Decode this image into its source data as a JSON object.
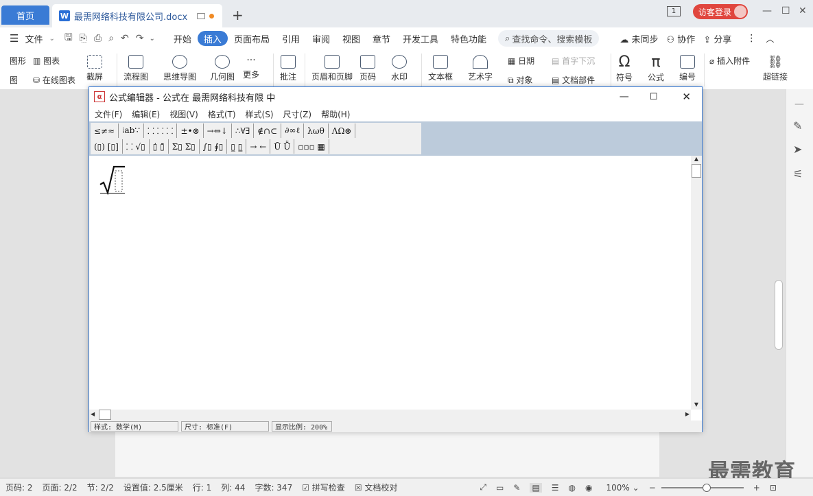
{
  "tabs": {
    "home": "首页",
    "doc": "最需网络科技有限公司.docx",
    "add": "+"
  },
  "topright": {
    "page_indicator": "1",
    "login": "访客登录"
  },
  "menu": {
    "file": "文件",
    "items": [
      "开始",
      "插入",
      "页面布局",
      "引用",
      "审阅",
      "视图",
      "章节",
      "开发工具",
      "特色功能"
    ],
    "active_index": 1,
    "search": "查找命令、搜索模板",
    "sync": "未同步",
    "collab": "协作",
    "share": "分享"
  },
  "ribbon": {
    "shape": "图形",
    "chart": "图表",
    "diagram": "图",
    "online_chart": "在线图表",
    "screenshot": "截屏",
    "flowchart": "流程图",
    "mindmap": "思维导图",
    "geometry": "几何图",
    "more": "更多",
    "comment": "批注",
    "header_footer": "页眉和页脚",
    "page_num": "页码",
    "watermark": "水印",
    "textbox": "文本框",
    "wordart": "艺术字",
    "date": "日期",
    "object": "对象",
    "dropcap": "首字下沉",
    "docpart": "文档部件",
    "symbol": "符号",
    "formula": "公式",
    "numbering": "编号",
    "attach": "插入附件",
    "hyperlink": "超链接"
  },
  "dialog": {
    "title": "公式编辑器 - 公式在 最需网络科技有限 中",
    "menu": [
      "文件(F)",
      "编辑(E)",
      "视图(V)",
      "格式(T)",
      "样式(S)",
      "尺寸(Z)",
      "帮助(H)"
    ],
    "palette_row1": [
      "≤≠≈",
      "⁞ab∵",
      "⸬ ⸬ ⸬",
      "±•⊗",
      "→⇔↓",
      "∴∀∃",
      "∉∩⊂",
      "∂∞ℓ",
      "λωθ",
      "ΛΩ⊛"
    ],
    "palette_row2": [
      "(▯) [▯]",
      "⸬ √▯",
      "▯̇ ▯̄",
      "Σ▯ Σ▯",
      "∫▯ ∮▯",
      "▯̲ ▯̳",
      "→ ←",
      "Ū Ṻ",
      "▫▫▫ ▦"
    ],
    "status_style": "样式: 数学(M)",
    "status_size": "尺寸: 标准(F)",
    "status_zoom": "显示比例: 200%"
  },
  "status": {
    "page": "页码: 2",
    "pages": "页面: 2/2",
    "section": "节: 2/2",
    "setting": "设置值: 2.5厘米",
    "row": "行: 1",
    "col": "列: 44",
    "words": "字数: 347",
    "spell": "拼写检查",
    "proof": "文档校对",
    "zoom": "100%"
  },
  "watermark_text": "最需教育"
}
